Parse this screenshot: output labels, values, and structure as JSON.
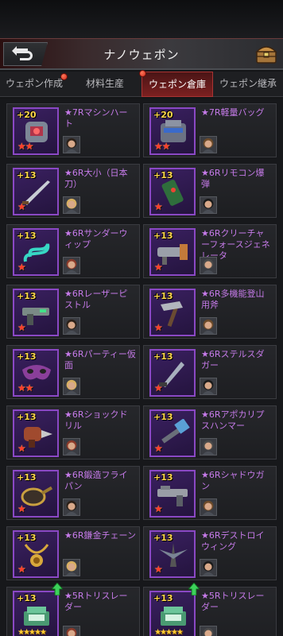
{
  "header": {
    "title": "ナノウェポン"
  },
  "tabs": [
    {
      "label": "ウェポン作成",
      "badge": true
    },
    {
      "label": "材料生産",
      "badge": false
    },
    {
      "label": "ウェポン倉庫",
      "badge": true,
      "active": true
    },
    {
      "label": "ウェポン継承",
      "badge": false
    }
  ],
  "colors": {
    "accent": "#7c2020",
    "rarity_border": "#8a48c4",
    "name_text": "#c57ae8",
    "level_text": "#ffd84a"
  },
  "items": [
    {
      "level": "+20",
      "name": "★7Rマシンハート",
      "stars": "★★",
      "weapon_icon": "machine-heart-icon",
      "avatar_icon": "avatar-soldier-icon"
    },
    {
      "level": "+20",
      "name": "★7R軽量バッグ",
      "stars": "★★",
      "weapon_icon": "light-bag-icon",
      "avatar_icon": "avatar-bald-icon"
    },
    {
      "level": "+13",
      "name": "★6R大小（日本刀）",
      "stars": "★",
      "weapon_icon": "katana-icon",
      "avatar_icon": "avatar-woman-dark-icon"
    },
    {
      "level": "+13",
      "name": "★6Rリモコン爆弾",
      "stars": "★",
      "weapon_icon": "remote-bomb-icon",
      "avatar_icon": "avatar-woman-blonde-icon"
    },
    {
      "level": "+13",
      "name": "★6Rサンダーウィップ",
      "stars": "★",
      "weapon_icon": "thunder-whip-icon",
      "avatar_icon": "avatar-man-fair-icon"
    },
    {
      "level": "+13",
      "name": "★6Rクリーチャーフォースジェネレータ",
      "stars": "★",
      "weapon_icon": "force-generator-icon",
      "avatar_icon": "avatar-man-green-icon"
    },
    {
      "level": "+13",
      "name": "★6Rレーザーピストル",
      "stars": "★",
      "weapon_icon": "laser-pistol-icon",
      "avatar_icon": "avatar-blonde-icon"
    },
    {
      "level": "+13",
      "name": "★6R多機能登山用斧",
      "stars": "★",
      "weapon_icon": "climbing-axe-icon",
      "avatar_icon": "avatar-man-dark-icon"
    },
    {
      "level": "+13",
      "name": "★6Rパーティー仮面",
      "stars": "★★",
      "weapon_icon": "party-mask-icon",
      "avatar_icon": "avatar-woman-smile-icon"
    },
    {
      "level": "+13",
      "name": "★6Rステルスダガー",
      "stars": "★",
      "weapon_icon": "stealth-dagger-icon",
      "avatar_icon": "avatar-man-beard-icon"
    },
    {
      "level": "+13",
      "name": "★6Rショックドリル",
      "stars": "★",
      "weapon_icon": "shock-drill-icon",
      "avatar_icon": "avatar-woman-red-icon"
    },
    {
      "level": "+13",
      "name": "★6Rアポカリプスハンマー",
      "stars": "★",
      "weapon_icon": "apocalypse-hammer-icon",
      "avatar_icon": "avatar-man-hood-icon"
    },
    {
      "level": "+13",
      "name": "★6R鍛造フライパン",
      "stars": "★",
      "weapon_icon": "frying-pan-icon",
      "avatar_icon": "avatar-woman-auburn-icon"
    },
    {
      "level": "+13",
      "name": "★6Rシャドウガン",
      "stars": "★",
      "weapon_icon": "shadow-gun-icon",
      "avatar_icon": "avatar-man-gray-icon"
    },
    {
      "level": "+13",
      "name": "★6R鎌金チェーン",
      "stars": "★",
      "weapon_icon": "gold-chain-icon",
      "avatar_icon": "avatar-man-cap-icon"
    },
    {
      "level": "+13",
      "name": "★6Rデストロイウィング",
      "stars": "★",
      "weapon_icon": "destroy-wing-icon",
      "avatar_icon": "avatar-man-old-icon"
    },
    {
      "level": "+13",
      "name": "★5Rトリスレーダー",
      "stars": "★★★★★",
      "weapon_icon": "tri-radar-icon",
      "avatar_icon": "avatar-girl-icon",
      "upgrade": true
    },
    {
      "level": "+13",
      "name": "★5Rトリスレーダー",
      "stars": "★★★★★",
      "weapon_icon": "tri-radar-icon",
      "avatar_icon": "avatar-man-young-icon",
      "upgrade": true
    }
  ]
}
